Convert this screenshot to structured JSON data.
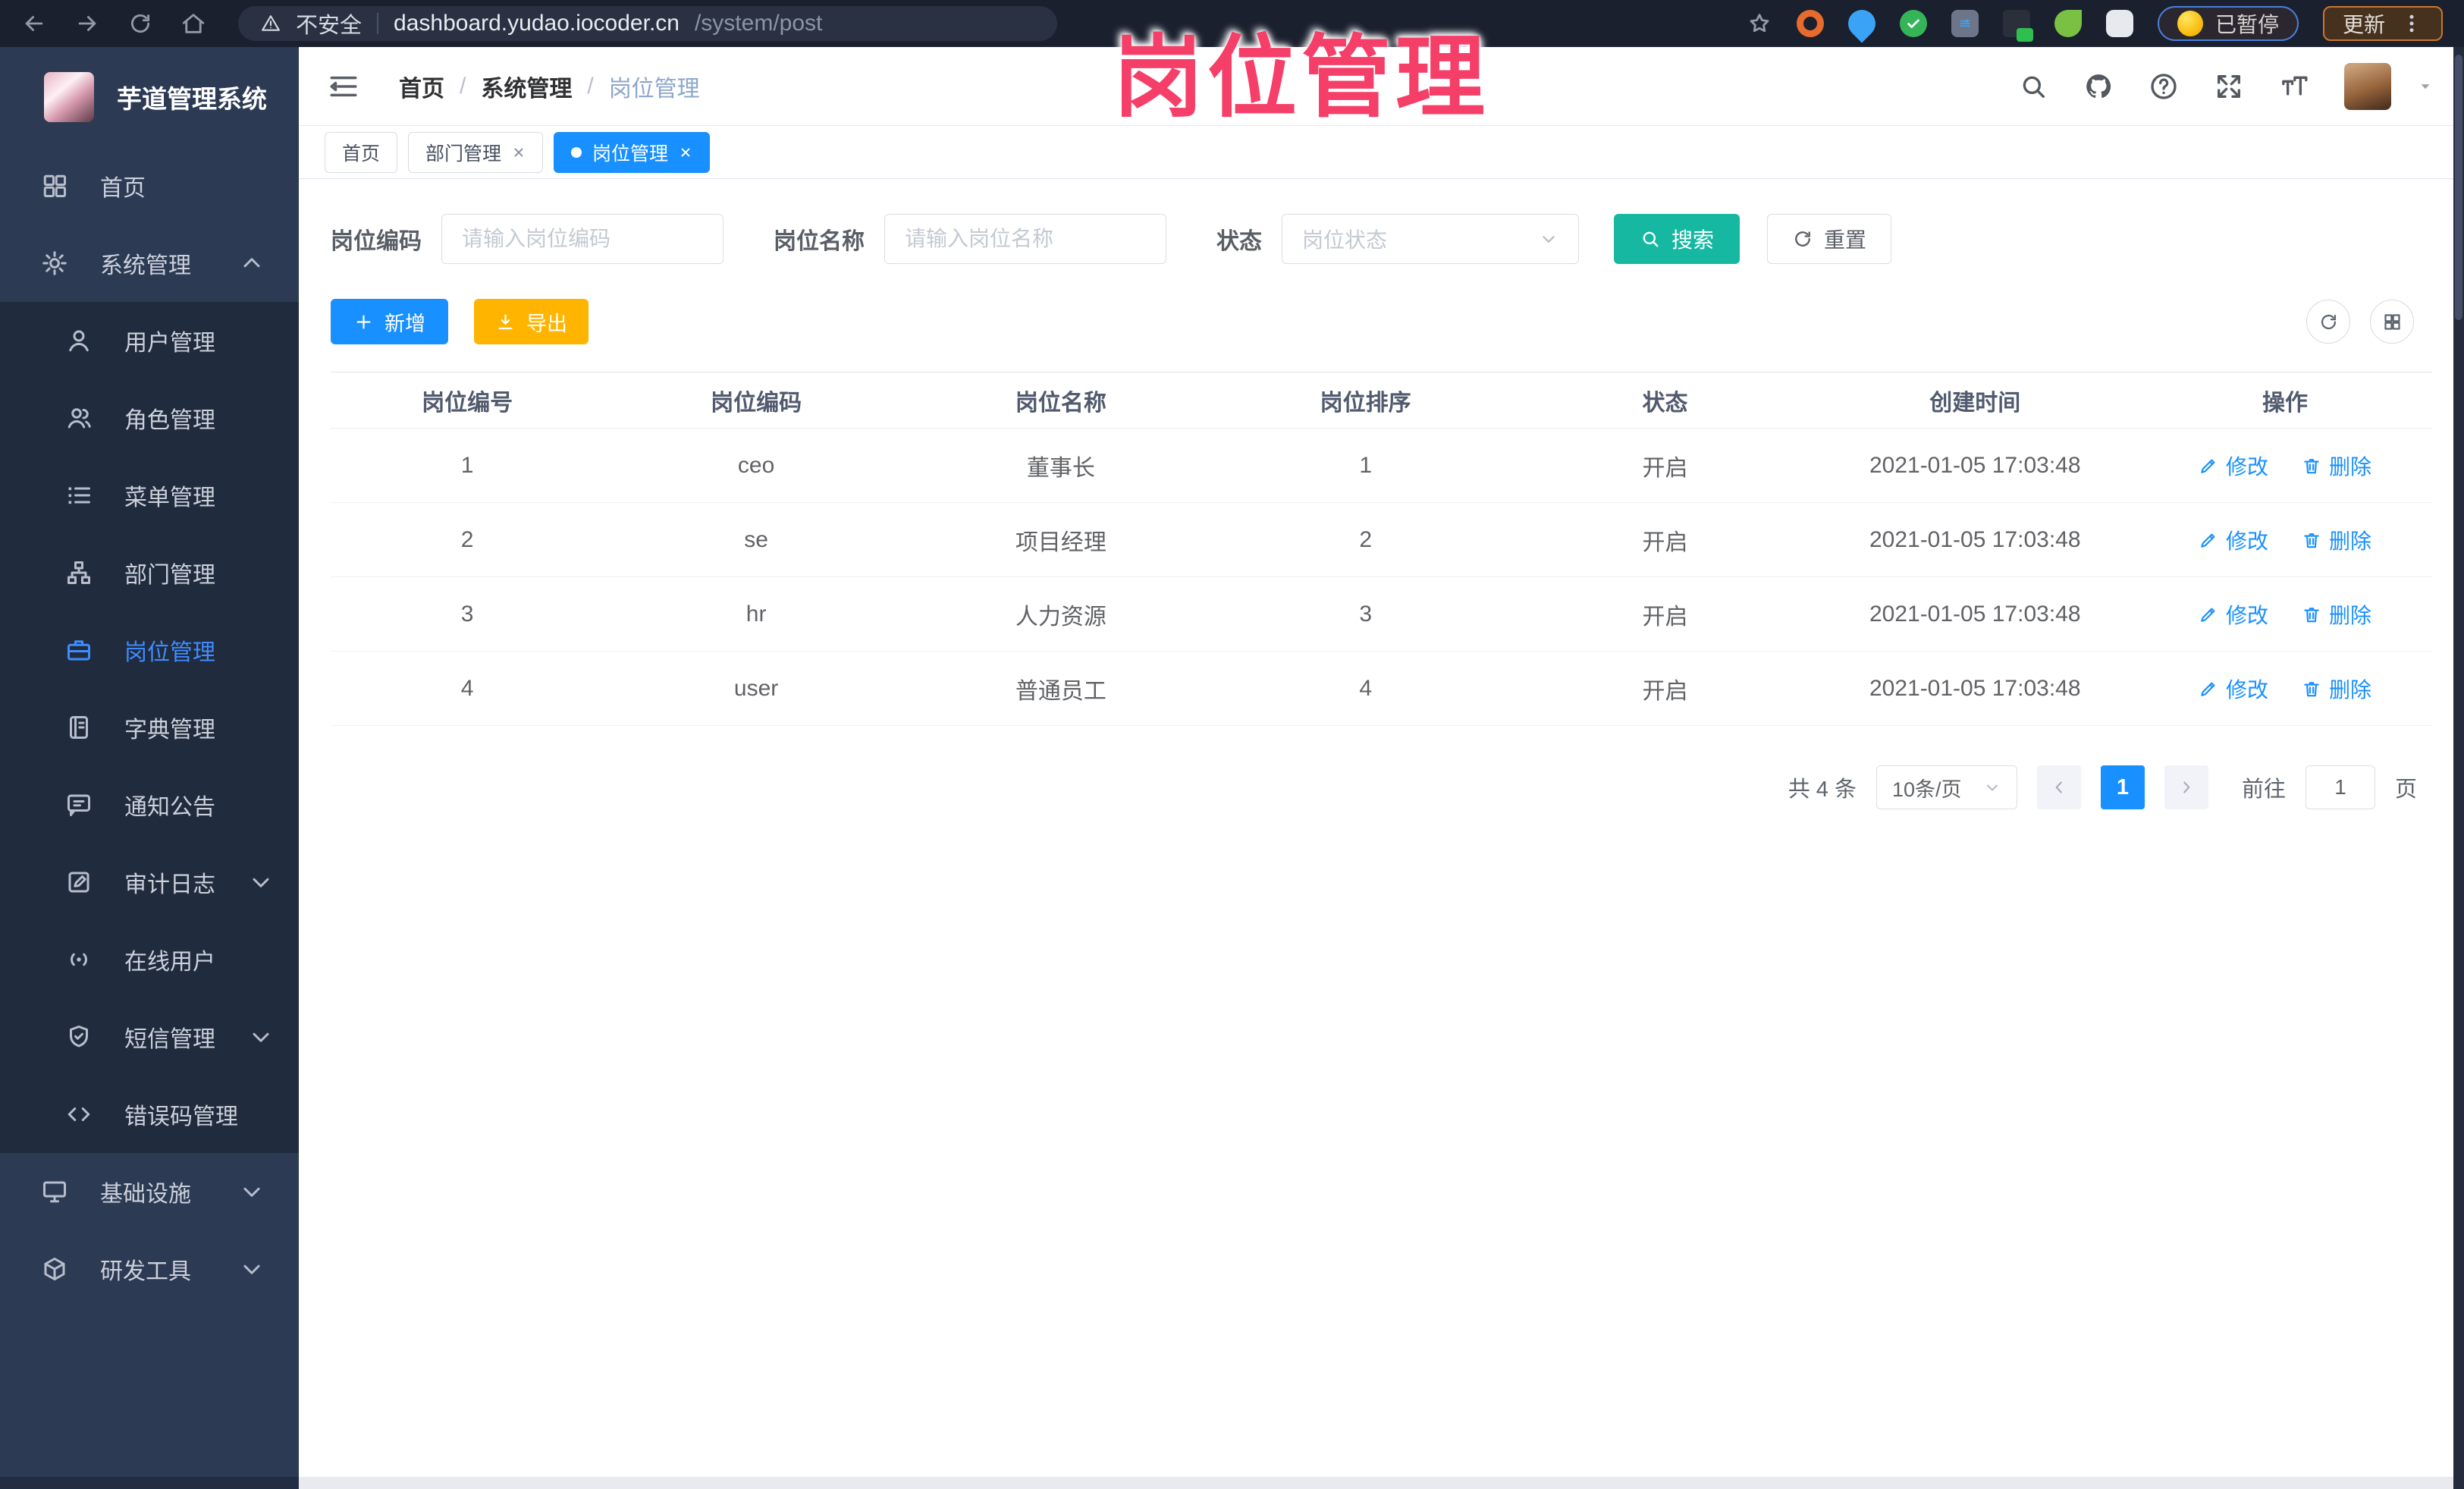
{
  "browser": {
    "security_label": "不安全",
    "url_host": "dashboard.yudao.iocoder.cn",
    "url_path": "/system/post",
    "paused_label": "已暂停",
    "update_label": "更新"
  },
  "watermark": "岗位管理",
  "sidebar": {
    "title": "芋道管理系统",
    "items": [
      {
        "label": "首页",
        "icon": "home-icon"
      },
      {
        "label": "系统管理",
        "icon": "gear-icon",
        "arrow": "up"
      },
      {
        "label": "用户管理",
        "icon": "user-icon"
      },
      {
        "label": "角色管理",
        "icon": "role-icon"
      },
      {
        "label": "菜单管理",
        "icon": "menu-list-icon"
      },
      {
        "label": "部门管理",
        "icon": "org-tree-icon"
      },
      {
        "label": "岗位管理",
        "icon": "briefcase-icon",
        "active": true
      },
      {
        "label": "字典管理",
        "icon": "dictionary-icon"
      },
      {
        "label": "通知公告",
        "icon": "announcement-icon"
      },
      {
        "label": "审计日志",
        "icon": "audit-log-icon",
        "arrow": "down"
      },
      {
        "label": "在线用户",
        "icon": "online-users-icon"
      },
      {
        "label": "短信管理",
        "icon": "sms-shield-icon",
        "arrow": "down"
      },
      {
        "label": "错误码管理",
        "icon": "error-code-icon"
      },
      {
        "label": "基础设施",
        "icon": "infrastructure-icon",
        "arrow": "down"
      },
      {
        "label": "研发工具",
        "icon": "devtools-icon",
        "arrow": "down"
      }
    ]
  },
  "header": {
    "breadcrumb": [
      "首页",
      "系统管理",
      "岗位管理"
    ],
    "separator": "/"
  },
  "tabs": [
    {
      "label": "首页",
      "active": false,
      "closable": false
    },
    {
      "label": "部门管理",
      "active": false,
      "closable": true
    },
    {
      "label": "岗位管理",
      "active": true,
      "closable": true
    }
  ],
  "filters": {
    "post_code_label": "岗位编码",
    "post_code_placeholder": "请输入岗位编码",
    "post_name_label": "岗位名称",
    "post_name_placeholder": "请输入岗位名称",
    "status_label": "状态",
    "status_placeholder": "岗位状态",
    "search_label": "搜索",
    "reset_label": "重置"
  },
  "toolbar": {
    "add_label": "新增",
    "export_label": "导出"
  },
  "table": {
    "columns": [
      "岗位编号",
      "岗位编码",
      "岗位名称",
      "岗位排序",
      "状态",
      "创建时间",
      "操作"
    ],
    "edit_label": "修改",
    "delete_label": "删除",
    "rows": [
      {
        "id": "1",
        "code": "ceo",
        "name": "董事长",
        "sort": "1",
        "status": "开启",
        "created": "2021-01-05 17:03:48"
      },
      {
        "id": "2",
        "code": "se",
        "name": "项目经理",
        "sort": "2",
        "status": "开启",
        "created": "2021-01-05 17:03:48"
      },
      {
        "id": "3",
        "code": "hr",
        "name": "人力资源",
        "sort": "3",
        "status": "开启",
        "created": "2021-01-05 17:03:48"
      },
      {
        "id": "4",
        "code": "user",
        "name": "普通员工",
        "sort": "4",
        "status": "开启",
        "created": "2021-01-05 17:03:48"
      }
    ]
  },
  "pagination": {
    "total": "共 4 条",
    "page_size": "10条/页",
    "page": "1",
    "goto_label": "前往",
    "goto_value": "1",
    "page_unit": "页"
  },
  "colors": {
    "accent_blue": "#1890ff",
    "search_teal": "#16b8a2",
    "export_amber": "#ffb400",
    "watermark_pink": "#f53e68",
    "sidebar_bg": "#2d3a54",
    "sidebar_submenu_bg": "#202b3d"
  }
}
